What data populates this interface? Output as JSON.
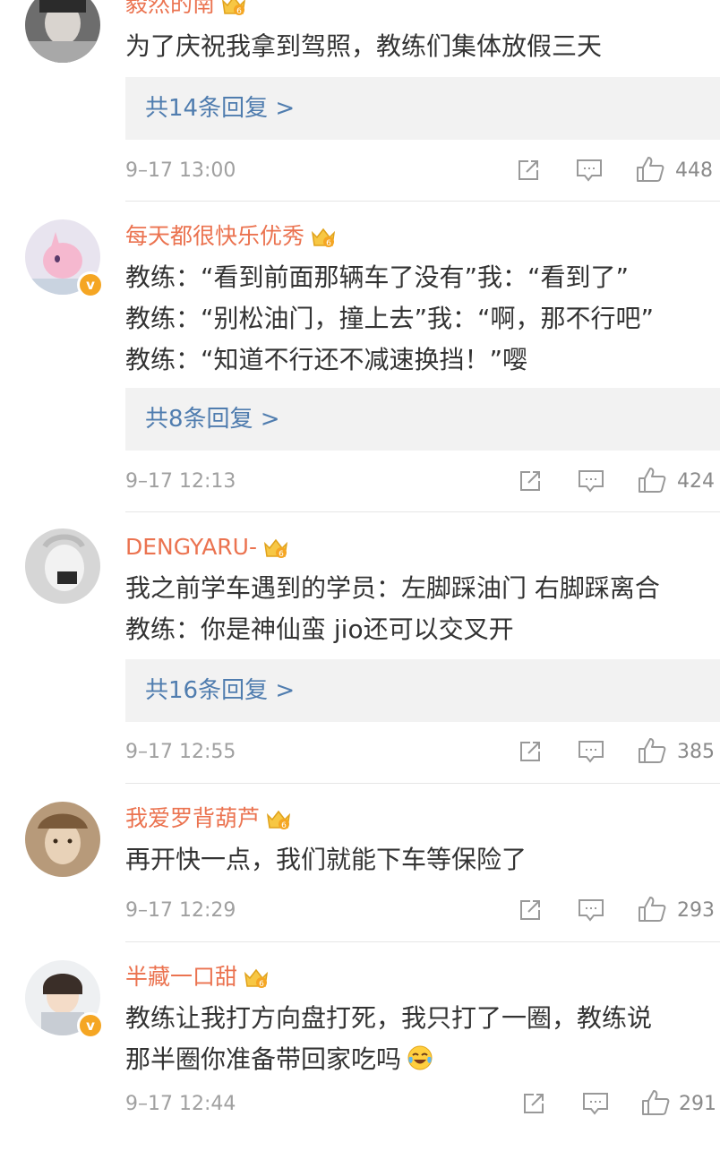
{
  "comments": [
    {
      "username": "毅然的南",
      "lines": [
        "为了庆祝我拿到驾照，教练们集体放假三天"
      ],
      "reply": "共14条回复 >",
      "time": "9–17 13:00",
      "likes": "448"
    },
    {
      "username": "每天都很快乐优秀",
      "lines": [
        "教练：“看到前面那辆车了没有”我：“看到了”",
        "教练：“别松油门，撞上去”我：“啊，那不行吧”",
        "教练：“知道不行还不减速换挡！”嘤"
      ],
      "reply": "共8条回复 >",
      "time": "9–17 12:13",
      "likes": "424"
    },
    {
      "username": "DENGYARU-",
      "lines": [
        "我之前学车遇到的学员：左脚踩油门 右脚踩离合",
        "教练：你是神仙蛮 jio还可以交叉开"
      ],
      "reply": "共16条回复 >",
      "time": "9–17 12:55",
      "likes": "385"
    },
    {
      "username": "我爱罗背葫芦",
      "lines": [
        "再开快一点，我们就能下车等保险了"
      ],
      "time": "9–17 12:29",
      "likes": "293"
    },
    {
      "username": "半藏一口甜",
      "lines": [
        "教练让我打方向盘打死，我只打了一圈，教练说",
        "那半圈你准备带回家吃吗"
      ],
      "time": "9–17 12:44",
      "likes": "291"
    }
  ],
  "icons": {
    "verified": "verified-badge-icon",
    "vip": "crown-vip-icon",
    "share": "share-icon",
    "comment": "comment-icon",
    "like": "like-icon",
    "emoji": "laugh-cry-emoji-icon"
  },
  "colors": {
    "username": "#eb7350",
    "reply_link": "#507daf",
    "reply_bg": "#f2f2f2",
    "meta": "#a0a0a0"
  }
}
